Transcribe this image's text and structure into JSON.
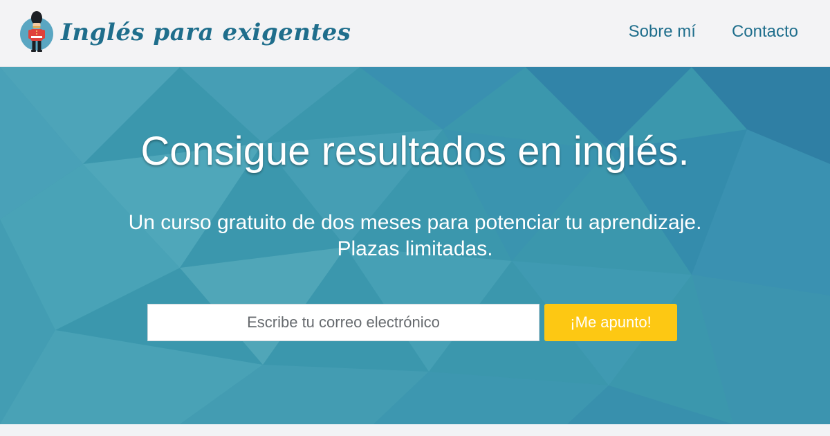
{
  "header": {
    "logo_text": "Inglés para exigentes",
    "nav": [
      {
        "label": "Sobre mí"
      },
      {
        "label": "Contacto"
      }
    ]
  },
  "hero": {
    "title": "Consigue resultados en inglés.",
    "subtitle_line1": "Un curso gratuito de dos meses para potenciar tu aprendizaje.",
    "subtitle_line2": "Plazas limitadas.",
    "email_placeholder": "Escribe tu correo electrónico",
    "email_value": "",
    "cta_label": "¡Me apunto!"
  },
  "colors": {
    "brand_text": "#1f6e8c",
    "hero_base": "#3b97ad",
    "cta": "#fdc813",
    "header_bg": "#f3f3f5"
  },
  "icons": {
    "logo": "royal-guard-icon"
  }
}
